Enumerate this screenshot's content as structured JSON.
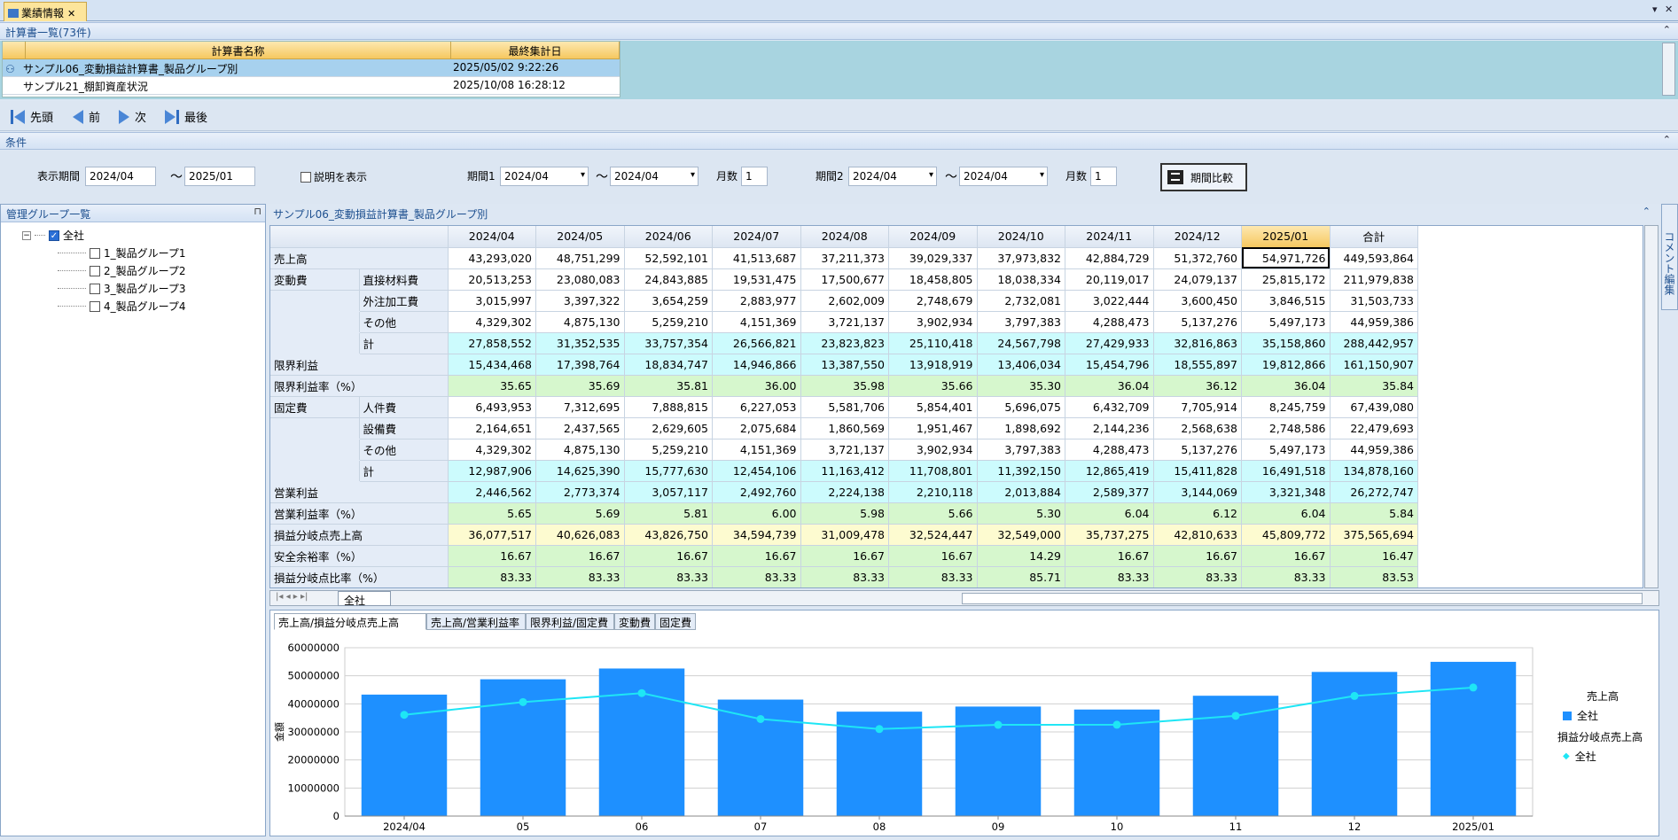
{
  "window": {
    "tab_title": "業績情報",
    "close_glyph": "✕",
    "menu_glyph": "▾",
    "window_close_glyph": "✕"
  },
  "book_list": {
    "header": "計算書一覧(73件)",
    "columns": [
      "計算書名称",
      "最終集計日"
    ],
    "rows": [
      {
        "name": "サンプル06_変動損益計算書_製品グループ別",
        "date": "2025/05/02 9:22:26",
        "selected": true
      },
      {
        "name": "サンプル21_棚卸資産状況",
        "date": "2025/10/08 16:28:12",
        "selected": false
      }
    ]
  },
  "nav": {
    "first": "先頭",
    "prev": "前",
    "next": "次",
    "last": "最後"
  },
  "conditions": {
    "header": "条件",
    "display_period_label": "表示期間",
    "display_from": "2024/04",
    "tilde": "〜",
    "display_to": "2025/01",
    "show_description_label": "説明を表示",
    "period1_label": "期間1",
    "period1_from": "2024/04",
    "period1_to": "2024/04",
    "months_label": "月数",
    "period1_months": "1",
    "period2_label": "期間2",
    "period2_from": "2024/04",
    "period2_to": "2024/04",
    "period2_months": "1",
    "compare_button": "期間比較"
  },
  "group_panel": {
    "header": "管理グループ一覧",
    "pin_glyph": "⊓",
    "root": "全社",
    "children": [
      "1_製品グループ1",
      "2_製品グループ2",
      "3_製品グループ3",
      "4_製品グループ4"
    ]
  },
  "report": {
    "title": "サンプル06_変動損益計算書_製品グループ別",
    "columns": [
      "2024/04",
      "2024/05",
      "2024/06",
      "2024/07",
      "2024/08",
      "2024/09",
      "2024/10",
      "2024/11",
      "2024/12",
      "2025/01",
      "合計"
    ],
    "rows": [
      {
        "cat": "売上高",
        "sub": "",
        "style": "plain",
        "values": [
          "43,293,020",
          "48,751,299",
          "52,592,101",
          "41,513,687",
          "37,211,373",
          "39,029,337",
          "37,973,832",
          "42,884,729",
          "51,372,760",
          "54,971,726",
          "449,593,864"
        ]
      },
      {
        "cat": "変動費",
        "sub": "直接材料費",
        "style": "plain",
        "values": [
          "20,513,253",
          "23,080,083",
          "24,843,885",
          "19,531,475",
          "17,500,677",
          "18,458,805",
          "18,038,334",
          "20,119,017",
          "24,079,137",
          "25,815,172",
          "211,979,838"
        ]
      },
      {
        "cat": "",
        "sub": "外注加工費",
        "style": "plain",
        "values": [
          "3,015,997",
          "3,397,322",
          "3,654,259",
          "2,883,977",
          "2,602,009",
          "2,748,679",
          "2,732,081",
          "3,022,444",
          "3,600,450",
          "3,846,515",
          "31,503,733"
        ]
      },
      {
        "cat": "",
        "sub": "その他",
        "style": "plain",
        "values": [
          "4,329,302",
          "4,875,130",
          "5,259,210",
          "4,151,369",
          "3,721,137",
          "3,902,934",
          "3,797,383",
          "4,288,473",
          "5,137,276",
          "5,497,173",
          "44,959,386"
        ]
      },
      {
        "cat": "",
        "sub": "計",
        "style": "calc",
        "values": [
          "27,858,552",
          "31,352,535",
          "33,757,354",
          "26,566,821",
          "23,823,823",
          "25,110,418",
          "24,567,798",
          "27,429,933",
          "32,816,863",
          "35,158,860",
          "288,442,957"
        ]
      },
      {
        "cat": "限界利益",
        "sub": "",
        "style": "calc",
        "values": [
          "15,434,468",
          "17,398,764",
          "18,834,747",
          "14,946,866",
          "13,387,550",
          "13,918,919",
          "13,406,034",
          "15,454,796",
          "18,555,897",
          "19,812,866",
          "161,150,907"
        ]
      },
      {
        "cat": "限界利益率（%）",
        "sub": "",
        "style": "rate",
        "values": [
          "35.65",
          "35.69",
          "35.81",
          "36.00",
          "35.98",
          "35.66",
          "35.30",
          "36.04",
          "36.12",
          "36.04",
          "35.84"
        ]
      },
      {
        "cat": "固定費",
        "sub": "人件費",
        "style": "plain",
        "values": [
          "6,493,953",
          "7,312,695",
          "7,888,815",
          "6,227,053",
          "5,581,706",
          "5,854,401",
          "5,696,075",
          "6,432,709",
          "7,705,914",
          "8,245,759",
          "67,439,080"
        ]
      },
      {
        "cat": "",
        "sub": "設備費",
        "style": "plain",
        "values": [
          "2,164,651",
          "2,437,565",
          "2,629,605",
          "2,075,684",
          "1,860,569",
          "1,951,467",
          "1,898,692",
          "2,144,236",
          "2,568,638",
          "2,748,586",
          "22,479,693"
        ]
      },
      {
        "cat": "",
        "sub": "その他",
        "style": "plain",
        "values": [
          "4,329,302",
          "4,875,130",
          "5,259,210",
          "4,151,369",
          "3,721,137",
          "3,902,934",
          "3,797,383",
          "4,288,473",
          "5,137,276",
          "5,497,173",
          "44,959,386"
        ]
      },
      {
        "cat": "",
        "sub": "計",
        "style": "calc",
        "values": [
          "12,987,906",
          "14,625,390",
          "15,777,630",
          "12,454,106",
          "11,163,412",
          "11,708,801",
          "11,392,150",
          "12,865,419",
          "15,411,828",
          "16,491,518",
          "134,878,160"
        ]
      },
      {
        "cat": "営業利益",
        "sub": "",
        "style": "calc",
        "values": [
          "2,446,562",
          "2,773,374",
          "3,057,117",
          "2,492,760",
          "2,224,138",
          "2,210,118",
          "2,013,884",
          "2,589,377",
          "3,144,069",
          "3,321,348",
          "26,272,747"
        ]
      },
      {
        "cat": "営業利益率（%）",
        "sub": "",
        "style": "rate",
        "values": [
          "5.65",
          "5.69",
          "5.81",
          "6.00",
          "5.98",
          "5.66",
          "5.30",
          "6.04",
          "6.12",
          "6.04",
          "5.84"
        ]
      },
      {
        "cat": "損益分岐点売上高",
        "sub": "",
        "style": "be",
        "values": [
          "36,077,517",
          "40,626,083",
          "43,826,750",
          "34,594,739",
          "31,009,478",
          "32,524,447",
          "32,549,000",
          "35,737,275",
          "42,810,633",
          "45,809,772",
          "375,565,694"
        ]
      },
      {
        "cat": "安全余裕率（%）",
        "sub": "",
        "style": "rate",
        "values": [
          "16.67",
          "16.67",
          "16.67",
          "16.67",
          "16.67",
          "16.67",
          "14.29",
          "16.67",
          "16.67",
          "16.67",
          "16.47"
        ]
      },
      {
        "cat": "損益分岐点比率（%）",
        "sub": "",
        "style": "rate",
        "values": [
          "83.33",
          "83.33",
          "83.33",
          "83.33",
          "83.33",
          "83.33",
          "85.71",
          "83.33",
          "83.33",
          "83.33",
          "83.53"
        ]
      }
    ],
    "selected_column": "2025/01",
    "sheet_tab": "全社",
    "comment_panel_label": "コメント編集"
  },
  "chart_tabs": [
    "売上高/損益分岐点売上高",
    "売上高/営業利益率",
    "限界利益/固定費",
    "変動費",
    "固定費"
  ],
  "chart_data": {
    "type": "bar",
    "categories": [
      "2024/04",
      "05",
      "06",
      "07",
      "08",
      "09",
      "10",
      "11",
      "12",
      "2025/01"
    ],
    "series": [
      {
        "name": "全社",
        "kind": "bar",
        "color": "#1e90ff",
        "values": [
          43293020,
          48751299,
          52592101,
          41513687,
          37211373,
          39029337,
          37973832,
          42884729,
          51372760,
          54971726
        ]
      },
      {
        "name": "全社",
        "kind": "line",
        "color": "#1ee6f5",
        "values": [
          36077517,
          40626083,
          43826750,
          34594739,
          31009478,
          32524447,
          32549000,
          35737275,
          42810633,
          45809772
        ]
      }
    ],
    "ylim": [
      0,
      60000000
    ],
    "yticks": [
      "0",
      "10000000",
      "20000000",
      "30000000",
      "40000000",
      "50000000",
      "60000000"
    ],
    "ylabel": "金額",
    "legend_groups": [
      "売上高",
      "損益分岐点売上高"
    ],
    "grid": true
  }
}
